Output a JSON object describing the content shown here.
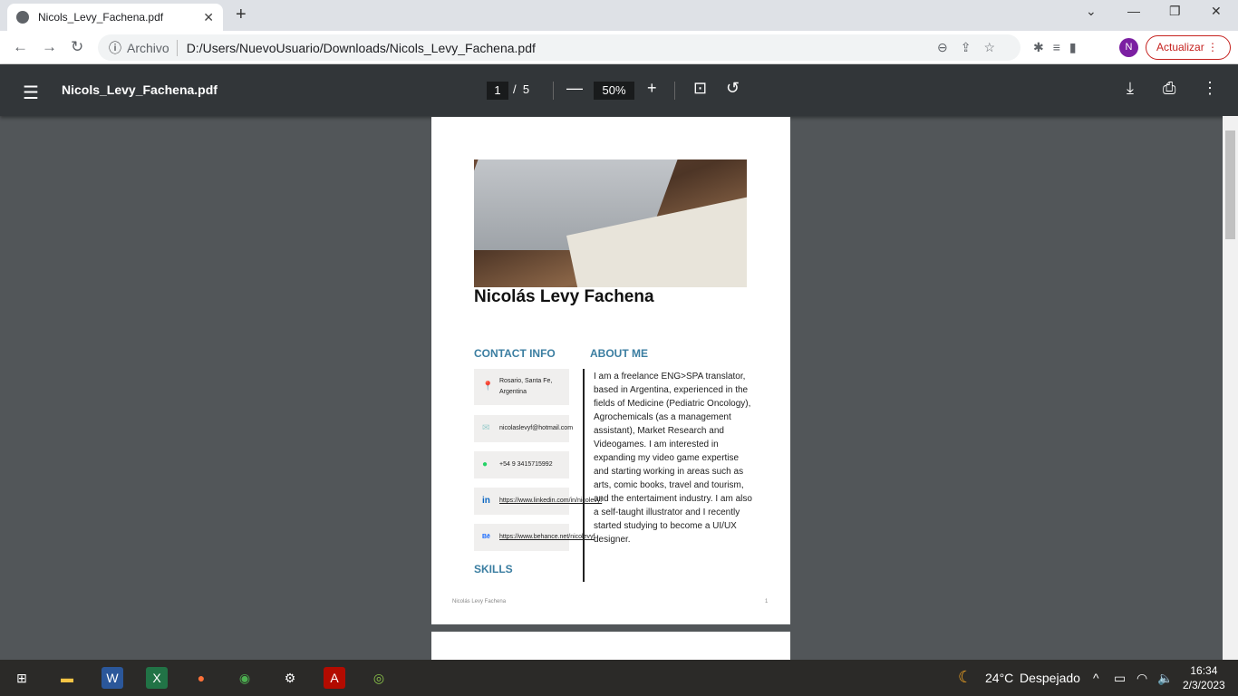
{
  "browser": {
    "tab_title": "Nicols_Levy_Fachena.pdf",
    "address_scheme": "Archivo",
    "address": "D:/Users/NuevoUsuario/Downloads/Nicols_Levy_Fachena.pdf",
    "profile_initial": "N",
    "update_label": "Actualizar"
  },
  "viewer": {
    "file_name": "Nicols_Levy_Fachena.pdf",
    "current_page": "1",
    "page_sep": "/",
    "total_pages": "5",
    "zoom": "50%"
  },
  "document": {
    "name": "Nicolás Levy Fachena",
    "contact_heading": "CONTACT INFO",
    "about_heading": "ABOUT ME",
    "skills_heading": "SKILLS",
    "contacts": [
      {
        "icon": "location-pin-icon",
        "text": "Rosario, Santa Fe, Argentina"
      },
      {
        "icon": "mail-icon",
        "text": "nicolaslevyf@hotmail.com"
      },
      {
        "icon": "whatsapp-icon",
        "text": "+54 9 3415715992"
      },
      {
        "icon": "linkedin-icon",
        "text": "https://www.linkedin.com/in/nicolevyf"
      },
      {
        "icon": "behance-icon",
        "text": "https://www.behance.net/nicolevyf"
      }
    ],
    "about": "I am a freelance ENG>SPA translator, based in Argentina, experienced in the fields of Medicine (Pediatric Oncology), Agrochemicals (as a management assistant), Market Research and Videogames. I am interested in expanding my video game expertise and starting working in areas such as arts, comic books, travel and tourism, and the entertaiment industry. I am also a self-taught illustrator and I recently started studying to become a UI/UX designer.",
    "footer_name": "Nicolás Levy Fachena",
    "footer_page": "1"
  },
  "taskbar": {
    "weather_temp": "24°C",
    "weather_desc": "Despejado",
    "time": "16:34",
    "date": "2/3/2023"
  },
  "colors": {
    "heading": "#3b7ea1",
    "toolbar": "#323639",
    "update": "#c5221f"
  }
}
